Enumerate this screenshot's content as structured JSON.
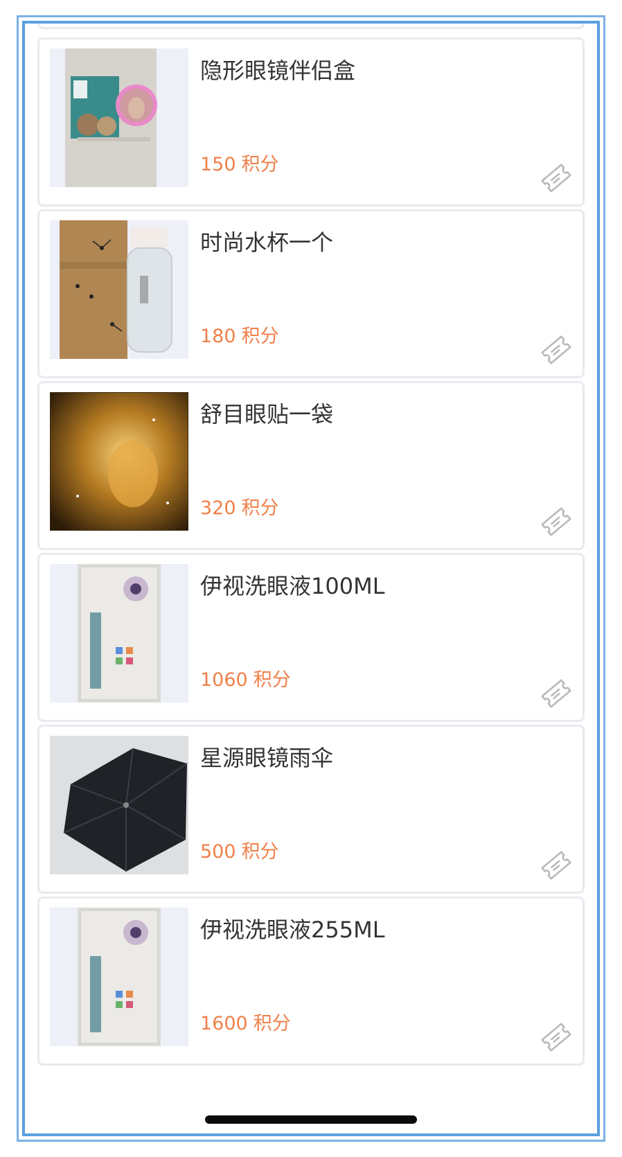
{
  "colors": {
    "frame": "#5aa0e0",
    "card_border": "#e9e9ef",
    "title": "#333333",
    "points": "#f0804a",
    "thumb_bg": "#eef0f8"
  },
  "points_unit": "积分",
  "products": [
    {
      "name": "隐形眼镜伴侣盒",
      "points": "150",
      "image": "contact-lens-case-image"
    },
    {
      "name": "时尚水杯一个",
      "points": "180",
      "image": "water-bottle-image"
    },
    {
      "name": "舒目眼贴一袋",
      "points": "320",
      "image": "eye-patch-image"
    },
    {
      "name": "伊视洗眼液100ML",
      "points": "1060",
      "image": "eye-wash-image"
    },
    {
      "name": "星源眼镜雨伞",
      "points": "500",
      "image": "umbrella-image"
    },
    {
      "name": "伊视洗眼液255ML",
      "points": "1600",
      "image": "eye-wash-image"
    }
  ],
  "icons": {
    "redeem": "ticket-icon"
  }
}
